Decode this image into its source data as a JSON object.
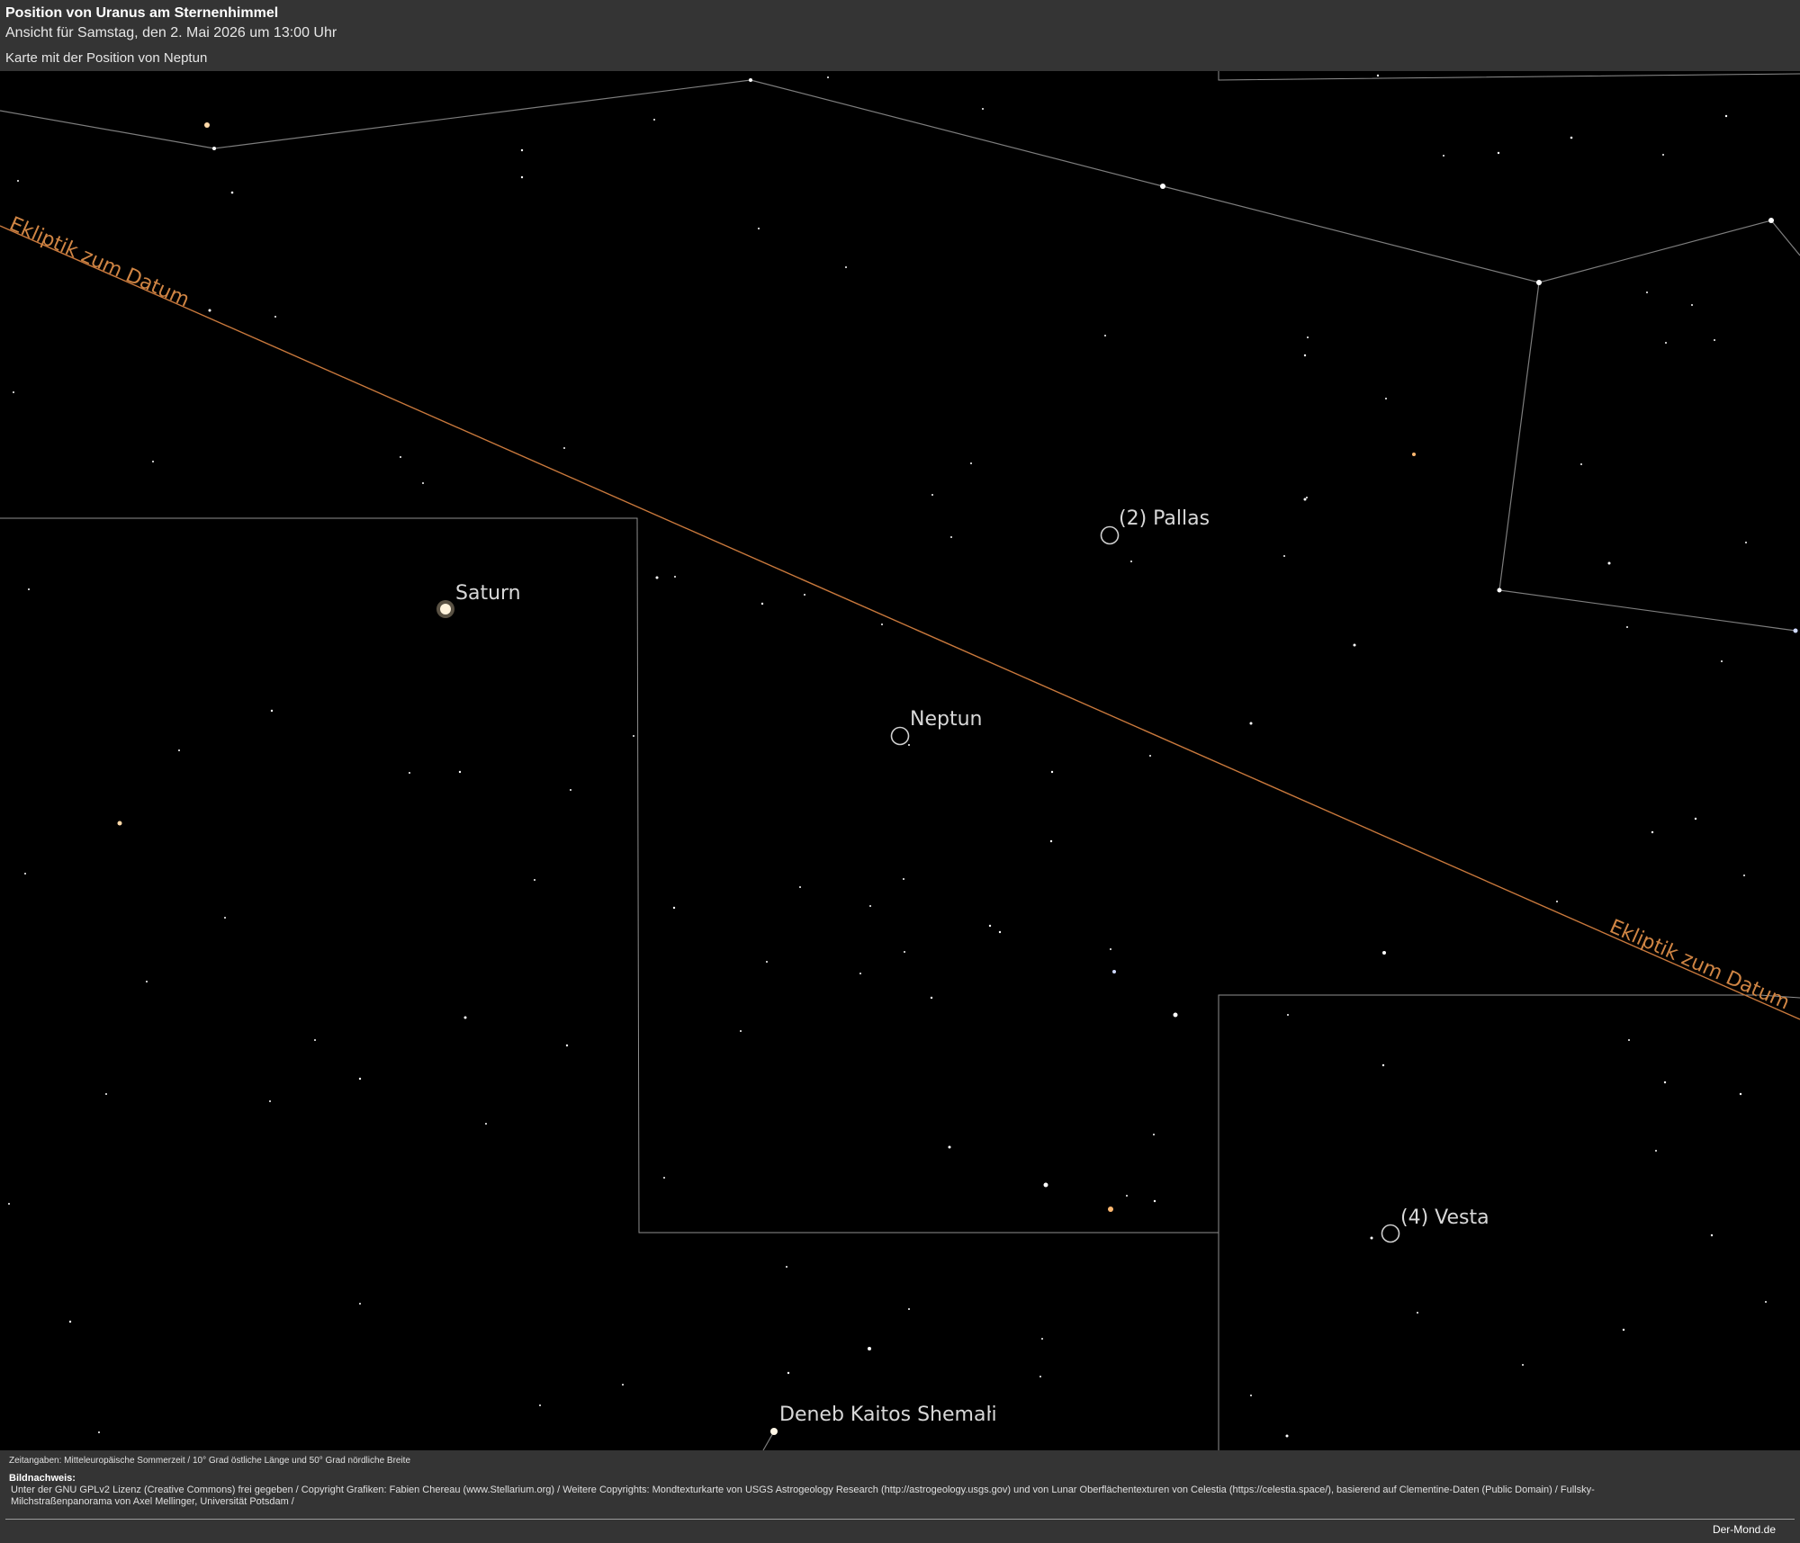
{
  "header": {
    "title": "Position von Uranus am Sternenhimmel",
    "subtitle": "Ansicht für Samstag, den 2. Mai 2026 um 13:00 Uhr",
    "map_caption": "Karte mit der Position von Neptun"
  },
  "sky": {
    "background": "#000000",
    "ecliptic": {
      "label": "Ekliptik zum Datum",
      "color": "#c8783c"
    },
    "constellation_line_color": "#8a8a8a",
    "boundary_line_color": "#9a9a9a",
    "objects": {
      "saturn": "Saturn",
      "neptun": "Neptun",
      "pallas": "(2) Pallas",
      "vesta": "(4) Vesta",
      "deneb": "Deneb Kaitos Shemali"
    }
  },
  "footer": {
    "time_note": "Zeitangaben: Mitteleuropäische Sommerzeit / 10° Grad östliche Länge und 50° Grad nördliche Breite",
    "credit_heading": "Bildnachweis:",
    "credit_text": "Unter der GNU GPLv2 Lizenz (Creative Commons) frei gegeben / Copyright Grafiken: Fabien Chereau (www.Stellarium.org) / Weitere Copyrights: Mondtexturkarte von USGS Astrogeology Research (http://astrogeology.usgs.gov) und von Lunar Oberflächentexturen von Celestia (https://celestia.space/), basierend auf Clementine-Daten (Public Domain) / Fullsky-Milchstraßenpanorama von Axel Mellinger, Universität Potsdam /",
    "site": "Der-Mond.de"
  }
}
